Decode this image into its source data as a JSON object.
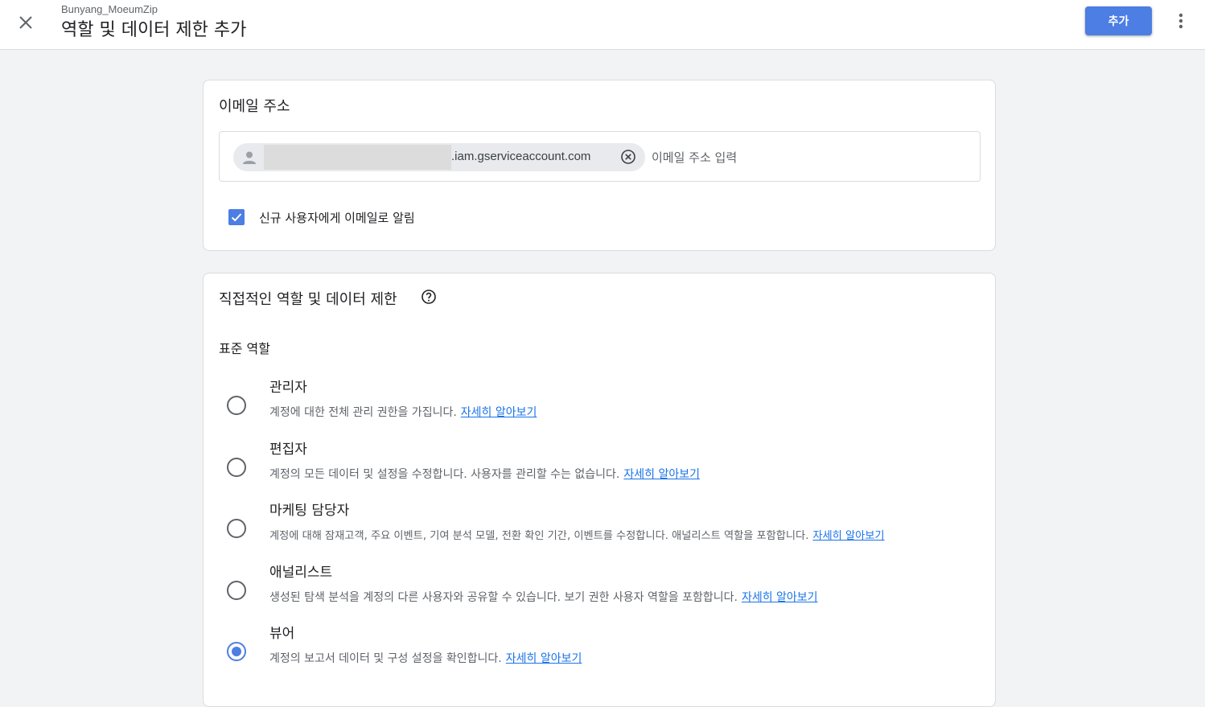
{
  "header": {
    "account_name": "Bunyang_MoeumZip",
    "title": "역할 및 데이터 제한 추가",
    "add_label": "추가"
  },
  "email_section": {
    "title": "이메일 주소",
    "chip_suffix": ".iam.gserviceaccount.com",
    "input_placeholder": "이메일 주소 입력",
    "notify_label": "신규 사용자에게 이메일로 알림",
    "notify_checked": true
  },
  "roles_section": {
    "title": "직접적인 역할 및 데이터 제한",
    "standard_label": "표준 역할",
    "learn_more_label": "자세히 알아보기",
    "roles": [
      {
        "name": "관리자",
        "description": "계정에 대한 전체 관리 권한을 가집니다.",
        "selected": false
      },
      {
        "name": "편집자",
        "description": "계정의 모든 데이터 및 설정을 수정합니다. 사용자를 관리할 수는 없습니다.",
        "selected": false
      },
      {
        "name": "마케팅 담당자",
        "description": "계정에 대해 잠재고객, 주요 이벤트, 기여 분석 모델, 전환 확인 기간, 이벤트를 수정합니다. 애널리스트 역할을 포함합니다.",
        "selected": false
      },
      {
        "name": "애널리스트",
        "description": "생성된 탐색 분석을 계정의 다른 사용자와 공유할 수 있습니다. 보기 권한 사용자 역할을 포함합니다.",
        "selected": false
      },
      {
        "name": "뷰어",
        "description": "계정의 보고서 데이터 및 구성 설정을 확인합니다.",
        "selected": true
      }
    ]
  },
  "colors": {
    "accent": "#4c7ee3",
    "link": "#1a73e8",
    "background": "#f1f3f4"
  },
  "icons": {
    "close": "close-icon",
    "more": "more-vert-icon",
    "avatar": "person-icon",
    "chip_remove": "cancel-circle-icon",
    "checkbox": "check-icon",
    "help": "help-circle-icon"
  }
}
